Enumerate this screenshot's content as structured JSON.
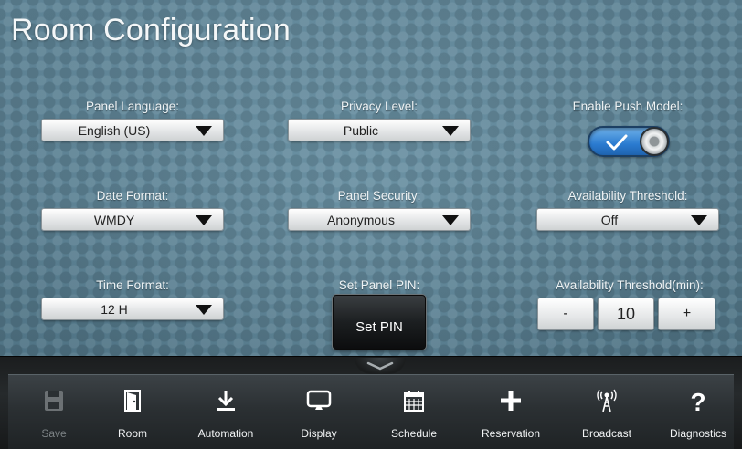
{
  "screen_title": "Room Configuration",
  "fields": {
    "panel_language": {
      "label": "Panel Language:",
      "value": "English (US)"
    },
    "privacy_level": {
      "label": "Privacy Level:",
      "value": "Public"
    },
    "enable_push_model": {
      "label": "Enable Push Model:",
      "enabled": true
    },
    "date_format": {
      "label": "Date Format:",
      "value": "WMDY"
    },
    "panel_security": {
      "label": "Panel Security:",
      "value": "Anonymous"
    },
    "availability_threshold": {
      "label": "Availability Threshold:",
      "value": "Off"
    },
    "time_format": {
      "label": "Time Format:",
      "value": "12 H"
    },
    "set_panel_pin": {
      "label": "Set Panel PIN:",
      "button": "Set PIN"
    },
    "availability_threshold_min": {
      "label": "Availability Threshold(min):",
      "decrement": "-",
      "value": "10",
      "increment": "+"
    }
  },
  "toolbar": {
    "tabs": [
      {
        "label": "Save",
        "icon": "save-icon",
        "enabled": false
      },
      {
        "label": "Room",
        "icon": "door-icon",
        "enabled": true
      },
      {
        "label": "Automation",
        "icon": "download-icon",
        "enabled": true
      },
      {
        "label": "Display",
        "icon": "monitor-icon",
        "enabled": true
      },
      {
        "label": "Schedule",
        "icon": "calendar-icon",
        "enabled": true
      },
      {
        "label": "Reservation",
        "icon": "plus-icon",
        "enabled": true
      },
      {
        "label": "Broadcast",
        "icon": "antenna-icon",
        "enabled": true
      },
      {
        "label": "Diagnostics",
        "icon": "question-icon",
        "enabled": true
      }
    ]
  },
  "colors": {
    "background": "#5a7f91",
    "toggle_on": "#2b7bd0",
    "toolbar": "#262a2c",
    "label_text": "#eef3f5",
    "disabled_text": "#7d8386"
  }
}
